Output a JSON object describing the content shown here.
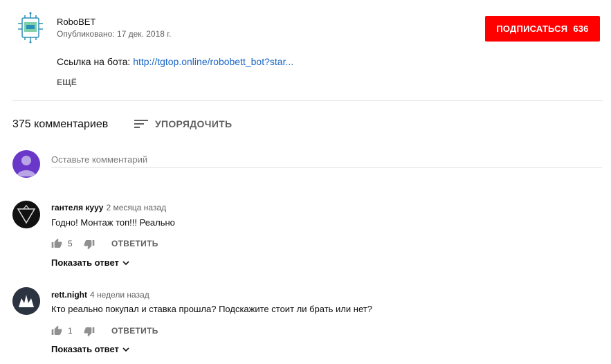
{
  "channel": {
    "name": "RoboBET",
    "published": "Опубликовано: 17 дек. 2018 г.",
    "subscribe_label": "ПОДПИСАТЬСЯ",
    "subscriber_count": "636",
    "description_prefix": "Ссылка на бота: ",
    "description_link": "http://tgtop.online/robobett_bot?star...",
    "more_label": "ЕЩЁ"
  },
  "comments_header": {
    "count": "375 комментариев",
    "sort_label": "УПОРЯДОЧИТЬ"
  },
  "add_comment": {
    "placeholder": "Оставьте комментарий"
  },
  "comments": [
    {
      "author": "гантеля куyy",
      "time": "2 месяца назад",
      "text": "Годно! Монтаж топ!!! Реально",
      "likes": "5",
      "reply_label": "ОТВЕТИТЬ",
      "show_replies": "Показать ответ"
    },
    {
      "author": "rett.night",
      "time": "4 недели назад",
      "text": "Кто реально покупал и ставка прошла?  Подскажите стоит ли брать или нет?",
      "likes": "1",
      "reply_label": "ОТВЕТИТЬ",
      "show_replies": "Показать ответ"
    }
  ],
  "colors": {
    "subscribe": "#ff0000",
    "link": "#1a66c7",
    "my_avatar": "#6a38c8"
  }
}
